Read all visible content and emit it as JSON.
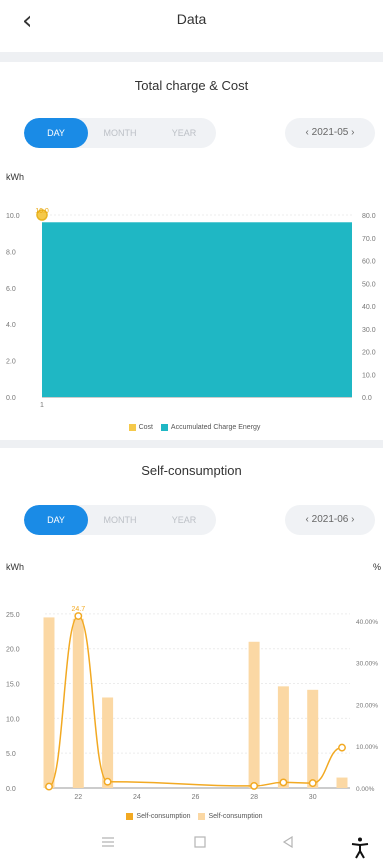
{
  "header": {
    "title": "Data",
    "back_icon": "chevron-left-icon"
  },
  "charge_section": {
    "title": "Total charge & Cost",
    "tabs": [
      "DAY",
      "MONTH",
      "YEAR"
    ],
    "active_tab": "DAY",
    "date": "‹  2021-05  ›",
    "unit_left": "kWh",
    "legend": [
      "Cost",
      "Accumulated Charge Energy"
    ]
  },
  "self_section": {
    "title": "Self-consumption",
    "tabs": [
      "DAY",
      "MONTH",
      "YEAR"
    ],
    "active_tab": "DAY",
    "date": "‹  2021-06  ›",
    "unit_left": "kWh",
    "unit_right": "%",
    "legend": [
      "Self-consumption",
      "Self-consumption"
    ]
  },
  "colors": {
    "accent": "#1a8be6",
    "teal": "#1fb7c4",
    "gold": "#f5b731",
    "orange": "#f2a922",
    "light_orange": "#fbd8a4"
  },
  "chart_data": [
    {
      "type": "bar",
      "title": "Total charge & Cost",
      "ylabel": "kWh",
      "yticks_left": [
        "0.0",
        "2.0",
        "4.0",
        "6.0",
        "8.0",
        "10.0"
      ],
      "yticks_right": [
        "0.0",
        "10.0",
        "20.0",
        "30.0",
        "40.0",
        "50.0",
        "60.0",
        "70.0",
        "80.0"
      ],
      "ylim_left": [
        0,
        10
      ],
      "ylim_right": [
        0,
        80
      ],
      "categories": [
        "1"
      ],
      "series": [
        {
          "name": "Accumulated Charge Energy",
          "type": "bar",
          "axis": "left",
          "values": [
            9.6
          ]
        },
        {
          "name": "Cost",
          "type": "line",
          "axis": "left",
          "values": [
            10.0
          ]
        }
      ],
      "data_labels": [
        "10.0"
      ]
    },
    {
      "type": "bar",
      "title": "Self-consumption",
      "ylabel": "kWh",
      "y2label": "%",
      "yticks_left": [
        "0.0",
        "5.0",
        "10.0",
        "15.0",
        "20.0",
        "25.0"
      ],
      "yticks_right": [
        "0.00%",
        "10.00%",
        "20.00%",
        "30.00%",
        "40.00%"
      ],
      "ylim_left": [
        0,
        27
      ],
      "ylim_right": [
        0,
        45
      ],
      "xticks": [
        "22",
        "24",
        "26",
        "28",
        "30"
      ],
      "x": [
        21,
        22,
        23,
        28,
        29,
        30,
        31
      ],
      "series": [
        {
          "name": "Self-consumption",
          "type": "bar",
          "axis": "left",
          "values": [
            24.5,
            24.3,
            13.0,
            21.0,
            14.6,
            14.1,
            1.5
          ]
        },
        {
          "name": "Self-consumption",
          "type": "line",
          "axis": "left",
          "values": [
            0.2,
            24.7,
            0.9,
            0.3,
            0.8,
            0.7,
            5.8
          ]
        }
      ],
      "data_labels": [
        "24.7"
      ]
    }
  ],
  "navbar": {
    "items": [
      "menu-icon",
      "square-icon",
      "back-triangle-icon"
    ],
    "accessibility": "accessibility-icon"
  }
}
